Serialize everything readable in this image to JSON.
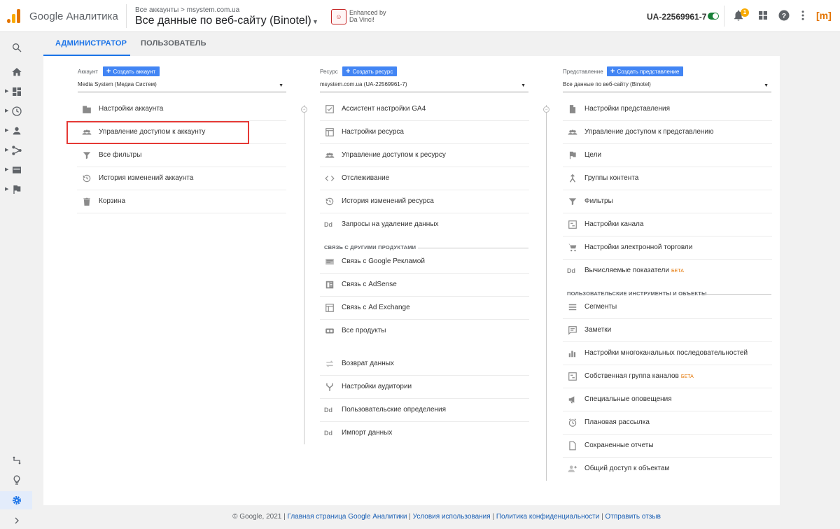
{
  "header": {
    "brand": "Google Аналитика",
    "breadcrumb": "Все аккаунты > msystem.com.ua",
    "view_title": "Все данные по веб-сайту (Binotel)",
    "extension_text_1": "Enhanced by",
    "extension_text_2": "Da Vinci!",
    "property_id": "UA-22569961-7",
    "notification_count": "1",
    "brand_mark": "[m]",
    "accent_color": "#1a73e8",
    "brand_color": "#e37400"
  },
  "tabs": [
    {
      "label": "АДМИНИСТРАТОР",
      "active": true
    },
    {
      "label": "ПОЛЬЗОВАТЕЛЬ",
      "active": false
    }
  ],
  "account": {
    "label": "Аккаунт",
    "create_label": "Создать аккаунт",
    "selected": "Media System (Медиа Систем)",
    "items": [
      {
        "label": "Настройки аккаунта",
        "icon": "building-icon"
      },
      {
        "label": "Управление доступом к аккаунту",
        "icon": "people-icon"
      },
      {
        "label": "Все фильтры",
        "icon": "filter-icon"
      },
      {
        "label": "История изменений аккаунта",
        "icon": "history-icon"
      },
      {
        "label": "Корзина",
        "icon": "trash-icon"
      }
    ]
  },
  "property": {
    "label": "Ресурс",
    "create_label": "Создать ресурс",
    "selected": "msystem.com.ua (UA-22569961-7)",
    "items": [
      {
        "label": "Ассистент настройки GA4",
        "icon": "checkbox-icon"
      },
      {
        "label": "Настройки ресурса",
        "icon": "window-icon"
      },
      {
        "label": "Управление доступом к ресурсу",
        "icon": "people-icon"
      },
      {
        "label": "Отслеживание",
        "icon": "code-icon"
      },
      {
        "label": "История изменений ресурса",
        "icon": "history-icon"
      },
      {
        "label": "Запросы на удаление данных",
        "icon": "dd-icon"
      }
    ],
    "links_title": "СВЯЗЬ С ДРУГИМИ ПРОДУКТАМИ",
    "links": [
      {
        "label": "Связь с Google Рекламой",
        "icon": "ads-icon"
      },
      {
        "label": "Связь с AdSense",
        "icon": "adsense-icon"
      },
      {
        "label": "Связь с Ad Exchange",
        "icon": "adx-icon"
      },
      {
        "label": "Все продукты",
        "icon": "products-icon"
      }
    ],
    "more": [
      {
        "label": "Возврат данных",
        "icon": "exchange-icon"
      },
      {
        "label": "Настройки аудитории",
        "icon": "fork-icon"
      },
      {
        "label": "Пользовательские определения",
        "icon": "dd-icon"
      },
      {
        "label": "Импорт данных",
        "icon": "dd-icon"
      }
    ]
  },
  "view": {
    "label": "Представление",
    "create_label": "Создать представление",
    "selected": "Все данные по веб-сайту (Binotel)",
    "items": [
      {
        "label": "Настройки представления",
        "icon": "doc-icon"
      },
      {
        "label": "Управление доступом к представлению",
        "icon": "people-icon"
      },
      {
        "label": "Цели",
        "icon": "flag-icon"
      },
      {
        "label": "Группы контента",
        "icon": "merge-icon"
      },
      {
        "label": "Фильтры",
        "icon": "filter-icon"
      },
      {
        "label": "Настройки канала",
        "icon": "channel-icon"
      },
      {
        "label": "Настройки электронной торговли",
        "icon": "cart-icon"
      },
      {
        "label": "Вычисляемые показатели",
        "icon": "dd-icon",
        "badge": "БЕТА"
      }
    ],
    "tools_title": "ПОЛЬЗОВАТЕЛЬСКИЕ ИНСТРУМЕНТЫ И ОБЪЕКТЫ",
    "tools": [
      {
        "label": "Сегменты",
        "icon": "segments-icon"
      },
      {
        "label": "Заметки",
        "icon": "note-icon"
      },
      {
        "label": "Настройки многоканальных последовательностей",
        "icon": "bars-icon"
      },
      {
        "label": "Собственная группа каналов",
        "icon": "channel-icon",
        "badge": "БЕТА"
      },
      {
        "label": "Специальные оповещения",
        "icon": "megaphone-icon"
      },
      {
        "label": "Плановая рассылка",
        "icon": "clock-icon"
      },
      {
        "label": "Сохраненные отчеты",
        "icon": "file-icon"
      },
      {
        "label": "Общий доступ к объектам",
        "icon": "person-add-icon"
      }
    ]
  },
  "footer": {
    "copyright": "© ",
    "copyright_2": " Google, 2021 | ",
    "link_home": "Главная страница Google Аналитики",
    "link_terms": "Условия использования",
    "link_privacy": "Политика конфиденциальности",
    "link_feedback": "Отправить отзыв",
    "separator": " | "
  }
}
